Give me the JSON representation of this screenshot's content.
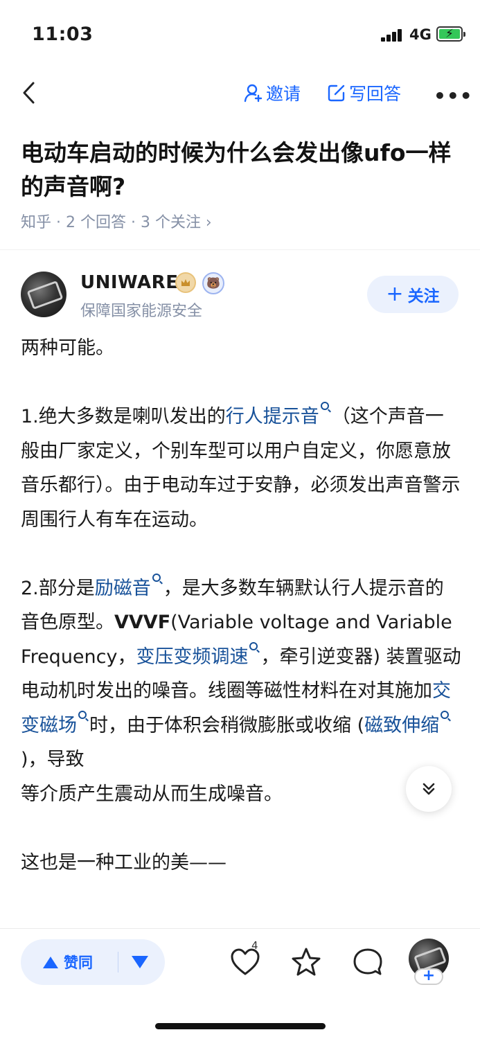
{
  "status_bar": {
    "time": "11:03",
    "network": "4G"
  },
  "nav": {
    "invite_label": "邀请",
    "write_answer_label": "写回答",
    "more_label": "•••"
  },
  "question": {
    "title": "电动车启动的时候为什么会发出像ufo一样的声音啊?",
    "meta": "知乎 · 2 个回答 · 3 个关注 ›"
  },
  "author": {
    "name": "UNIWARE",
    "signature": "保障国家能源安全",
    "follow_label": "关注",
    "badge_char": "🐻"
  },
  "answer": {
    "p1": "两种可能。",
    "p2_a": "1.绝大多数是喇叭发出的",
    "p2_link": "行人提示音",
    "p2_b": "（这个声音一般由厂家定义，个别车型可以用户自定义，你愿意放音乐都行）。由于电动车过于安静，必须发出声音警示周围行人有车在运动。",
    "p3_a": "2.部分是",
    "p3_link1": "励磁音",
    "p3_b": "，是大多数车辆默认行人提示音的音色原型。",
    "p3_bold": "VVVF",
    "p3_c": "(Variable voltage and Variable Frequency，",
    "p3_link2": "变压变频调速",
    "p3_d": "，牵引逆变器) 装置驱动电动机时发出的噪音。线圈等磁性材料在对其施加",
    "p3_link3": "交变磁场",
    "p3_e": "时，由于体积会稍微膨胀或收缩 (",
    "p3_link4": "磁致伸缩",
    "p3_f": ")，导致",
    "p3_g": "等介质产生震动从而生成噪音。",
    "p4": "这也是一种工业的美——"
  },
  "bottom_bar": {
    "vote_label": "赞同",
    "like_count": "4",
    "add_label": "+"
  },
  "colors": {
    "accent": "#1a66ff",
    "link": "#175199",
    "meta": "#8590a6"
  }
}
